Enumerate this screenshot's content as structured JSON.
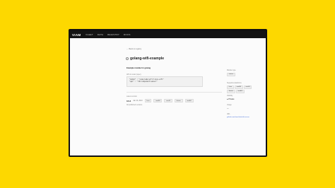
{
  "nav": {
    "logo": "VIAM",
    "links": [
      "FLEET",
      "DATA",
      "REGISTRY",
      "DOCS"
    ]
  },
  "back_link": "← Back to registry",
  "module": {
    "title": "golang-wifi-example",
    "description": "Example module for golang"
  },
  "api_label": "API & model (spec)",
  "code_lines": [
    "\"model\" : \"viam-labs:wifi:linux-wifi\"",
    "\"api\" : \"rdk:component:sensor\""
  ],
  "version": {
    "label": "Latest version",
    "number": "0.0.4",
    "date": "Jan 24, 2024",
    "platforms": [
      "linux",
      "amd64",
      "arm64",
      "darwin",
      "amd64"
    ]
  },
  "all_versions": "All published versions",
  "sidebar": {
    "module_type_label": "Module type",
    "module_type": "sensor",
    "platforms_label": "Supported platforms",
    "platforms": [
      "linux",
      "amd64",
      "arm64",
      "darwin",
      "amd64"
    ],
    "visibility_label": "Visibility",
    "visibility": "Private",
    "usage_label": "Usage",
    "usage": "—",
    "url_label": "URL",
    "url": "github.com/viam-labs/wifi-sensor"
  },
  "colors": {
    "background": "#fdd800",
    "nav": "#141414",
    "link": "#2a5bd7"
  }
}
